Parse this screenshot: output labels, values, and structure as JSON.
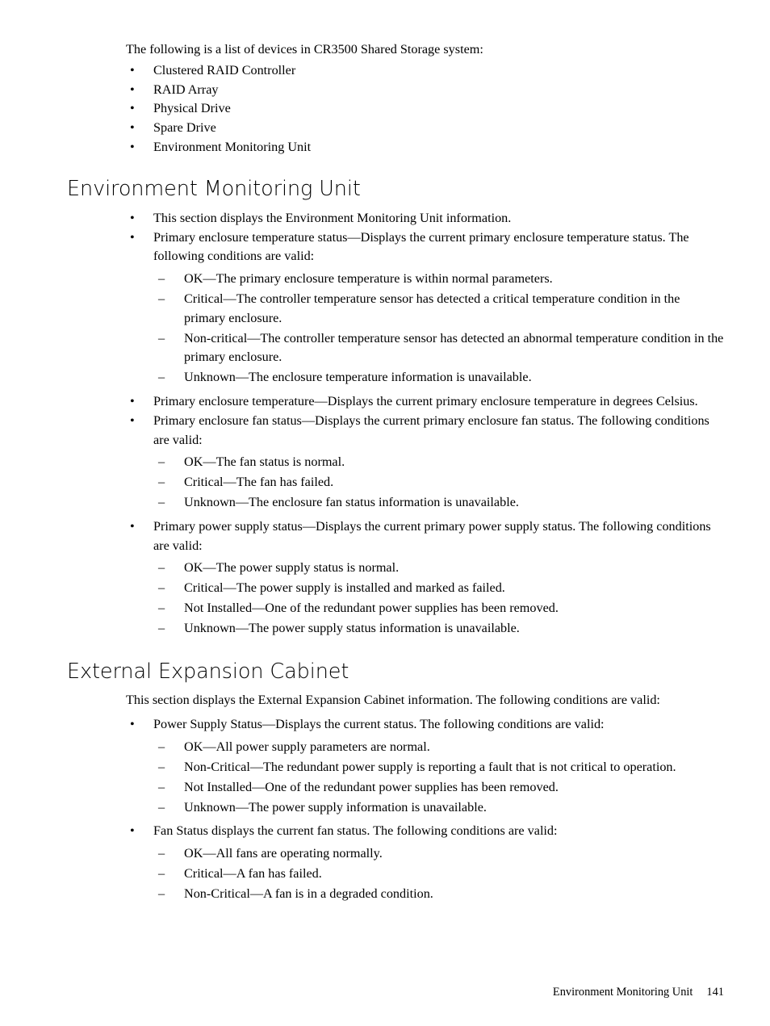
{
  "document": {
    "intro_paragraph": "The following is a list of devices in CR3500 Shared Storage system:",
    "device_list": [
      "Clustered RAID Controller",
      "RAID Array",
      "Physical Drive",
      "Spare Drive",
      "Environment Monitoring Unit"
    ],
    "bullet_glyph": "•",
    "dash_glyph": "–"
  },
  "section_emu": {
    "heading": "Environment Monitoring Unit",
    "bullets": [
      {
        "text": "This section displays the Environment Monitoring Unit information."
      },
      {
        "text": "Primary enclosure temperature status—Displays the current primary enclosure temperature status. The following conditions are valid:",
        "sub": [
          "OK—The primary enclosure temperature is within normal parameters.",
          "Critical—The controller temperature sensor has detected a critical temperature condition in the primary enclosure.",
          "Non-critical—The controller temperature sensor has detected an abnormal temperature condition in the primary enclosure.",
          "Unknown—The enclosure temperature information is unavailable."
        ]
      },
      {
        "text": "Primary enclosure temperature—Displays the current primary enclosure temperature in degrees Celsius."
      },
      {
        "text": "Primary enclosure fan status—Displays the current primary enclosure fan status. The following conditions are valid:",
        "sub": [
          "OK—The fan status is normal.",
          "Critical—The fan has failed.",
          "Unknown—The enclosure fan status information is unavailable."
        ]
      },
      {
        "text": "Primary power supply status—Displays the current primary power supply status. The following conditions are valid:",
        "sub": [
          "OK—The power supply status is normal.",
          "Critical—The power supply is installed and marked as failed.",
          "Not Installed—One of the redundant power supplies has been removed.",
          "Unknown—The power supply status information is unavailable."
        ]
      }
    ]
  },
  "section_eec": {
    "heading": "External Expansion Cabinet",
    "intro_paragraph": "This section displays the External Expansion Cabinet information. The following conditions are valid:",
    "bullets": [
      {
        "text": "Power Supply Status—Displays the current status. The following conditions are valid:",
        "sub": [
          "OK—All power supply parameters are normal.",
          "Non-Critical—The redundant power supply is reporting a fault that is not critical to operation.",
          "Not Installed—One of the redundant power supplies has been removed.",
          "Unknown—The power supply information is unavailable."
        ]
      },
      {
        "text": "Fan Status displays the current fan status. The following conditions are valid:",
        "sub": [
          "OK—All fans are operating normally.",
          "Critical—A fan has failed.",
          "Non-Critical—A fan is in a degraded condition."
        ]
      }
    ]
  },
  "footer": {
    "title": "Environment Monitoring Unit",
    "page_number": "141"
  }
}
